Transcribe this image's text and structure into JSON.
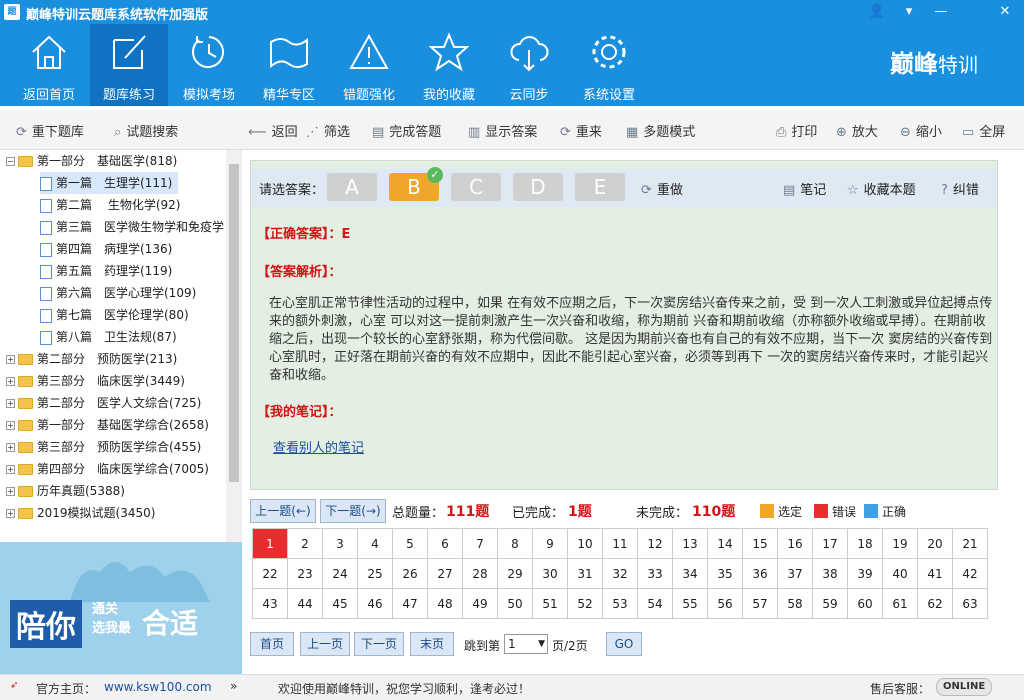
{
  "window": {
    "title": "巅峰特训云题库系统软件加强版",
    "controls": [
      "👤",
      "▾",
      "—",
      "✕"
    ]
  },
  "nav": {
    "items": [
      "返回首页",
      "题库练习",
      "模拟考场",
      "精华专区",
      "错题强化",
      "我的收藏",
      "云同步",
      "系统设置"
    ],
    "active": 1
  },
  "logo": {
    "text": "巅峰",
    "sub": "特训"
  },
  "toolbar": {
    "redownload": "重下题库",
    "search": "试题搜索",
    "back": "返回",
    "filter": "筛选",
    "finish": "完成答题",
    "show_answer": "显示答案",
    "redo": "重来",
    "multi_mode": "多题模式",
    "print": "打印",
    "zoom_in": "放大",
    "zoom_out": "缩小",
    "fullscreen": "全屏"
  },
  "tree": [
    {
      "label": "第一部分　基础医学(818)",
      "level": 0,
      "expanded": true
    },
    {
      "label": "第一篇　生理学(111)",
      "level": 1,
      "selected": true
    },
    {
      "label": "第二篇　 生物化学(92)",
      "level": 1
    },
    {
      "label": "第三篇　医学微生物学和免疫学",
      "level": 1
    },
    {
      "label": "第四篇　病理学(136)",
      "level": 1
    },
    {
      "label": "第五篇　药理学(119)",
      "level": 1
    },
    {
      "label": "第六篇　医学心理学(109)",
      "level": 1
    },
    {
      "label": "第七篇　医学伦理学(80)",
      "level": 1
    },
    {
      "label": "第八篇　卫生法规(87)",
      "level": 1
    },
    {
      "label": "第二部分　预防医学(213)",
      "level": 0
    },
    {
      "label": "第三部分　临床医学(3449)",
      "level": 0
    },
    {
      "label": "第二部分　医学人文综合(725)",
      "level": 0
    },
    {
      "label": "第一部分　基础医学综合(2658)",
      "level": 0
    },
    {
      "label": "第三部分　预防医学综合(455)",
      "level": 0
    },
    {
      "label": "第四部分　临床医学综合(7005)",
      "level": 0
    },
    {
      "label": "历年真题(5388)",
      "level": 0
    },
    {
      "label": "2019模拟试题(3450)",
      "level": 0
    }
  ],
  "banner": {
    "t1": "陪你",
    "t2": "通关\n选我最",
    "t3": "合适"
  },
  "answer_bar": {
    "label": "请选答案：",
    "options": [
      "A",
      "B",
      "C",
      "D",
      "E"
    ],
    "selected": "B",
    "redo": "重做",
    "note": "笔记",
    "favorite": "收藏本题",
    "correct": "纠错"
  },
  "question": {
    "correct_label": "【正确答案】：",
    "correct_value": "E",
    "analysis_label": "【答案解析】：",
    "analysis": "在心室肌正常节律性活动的过程中，如果 在有效不应期之后，下一次窦房结兴奋传来之前，受 到一次人工刺激或异位起搏点传来的额外刺激，心室 可以对这一提前刺激产生一次兴奋和收缩，称为期前 兴奋和期前收缩（亦称额外收缩或早搏）。在期前收 缩之后，出现一个较长的心室舒张期，称为代偿间歇。 这是因为期前兴奋也有自己的有效不应期，当下一次 窦房结的兴奋传到心室肌时，正好落在期前兴奋的有效不应期中，因此不能引起心室兴奋，必须等到再下 一次的窦房结兴奋传来时，才能引起兴奋和收缩。",
    "my_note_label": "【我的笔记】：",
    "others_note": "查看别人的笔记"
  },
  "counts": {
    "prev": "上一题(←)",
    "next": "下一题(→)",
    "total_label": "总题量：",
    "total": "111题",
    "done_label": "已完成：",
    "done": "1题",
    "undone_label": "未完成：",
    "undone": "110题",
    "legend_selected": "选定",
    "legend_wrong": "错误",
    "legend_right": "正确"
  },
  "grid_numbers": [
    1,
    2,
    3,
    4,
    5,
    6,
    7,
    8,
    9,
    10,
    11,
    12,
    13,
    14,
    15,
    16,
    17,
    18,
    19,
    20,
    21,
    22,
    23,
    24,
    25,
    26,
    27,
    28,
    29,
    30,
    31,
    32,
    33,
    34,
    35,
    36,
    37,
    38,
    39,
    40,
    41,
    42,
    43,
    44,
    45,
    46,
    47,
    48,
    49,
    50,
    51,
    52,
    53,
    54,
    55,
    56,
    57,
    58,
    59,
    60,
    61,
    62,
    63
  ],
  "current": 1,
  "pager": {
    "first": "首页",
    "prev": "上一页",
    "next": "下一页",
    "last": "末页",
    "jump_label": "跳到第",
    "page_value": "1",
    "page_suffix": "页/2页",
    "go": "GO"
  },
  "status": {
    "home_label": "官方主页：",
    "home_url": "www.ksw100.com",
    "welcome": "欢迎使用巅峰特训，祝您学习顺利，逢考必过！",
    "service": "售后客服：",
    "online": "ONLINE"
  },
  "colors": {
    "primary": "#1a8fde",
    "selected": "#f0a62a",
    "wrong": "#e62e2e",
    "right": "#3fa2e8"
  }
}
